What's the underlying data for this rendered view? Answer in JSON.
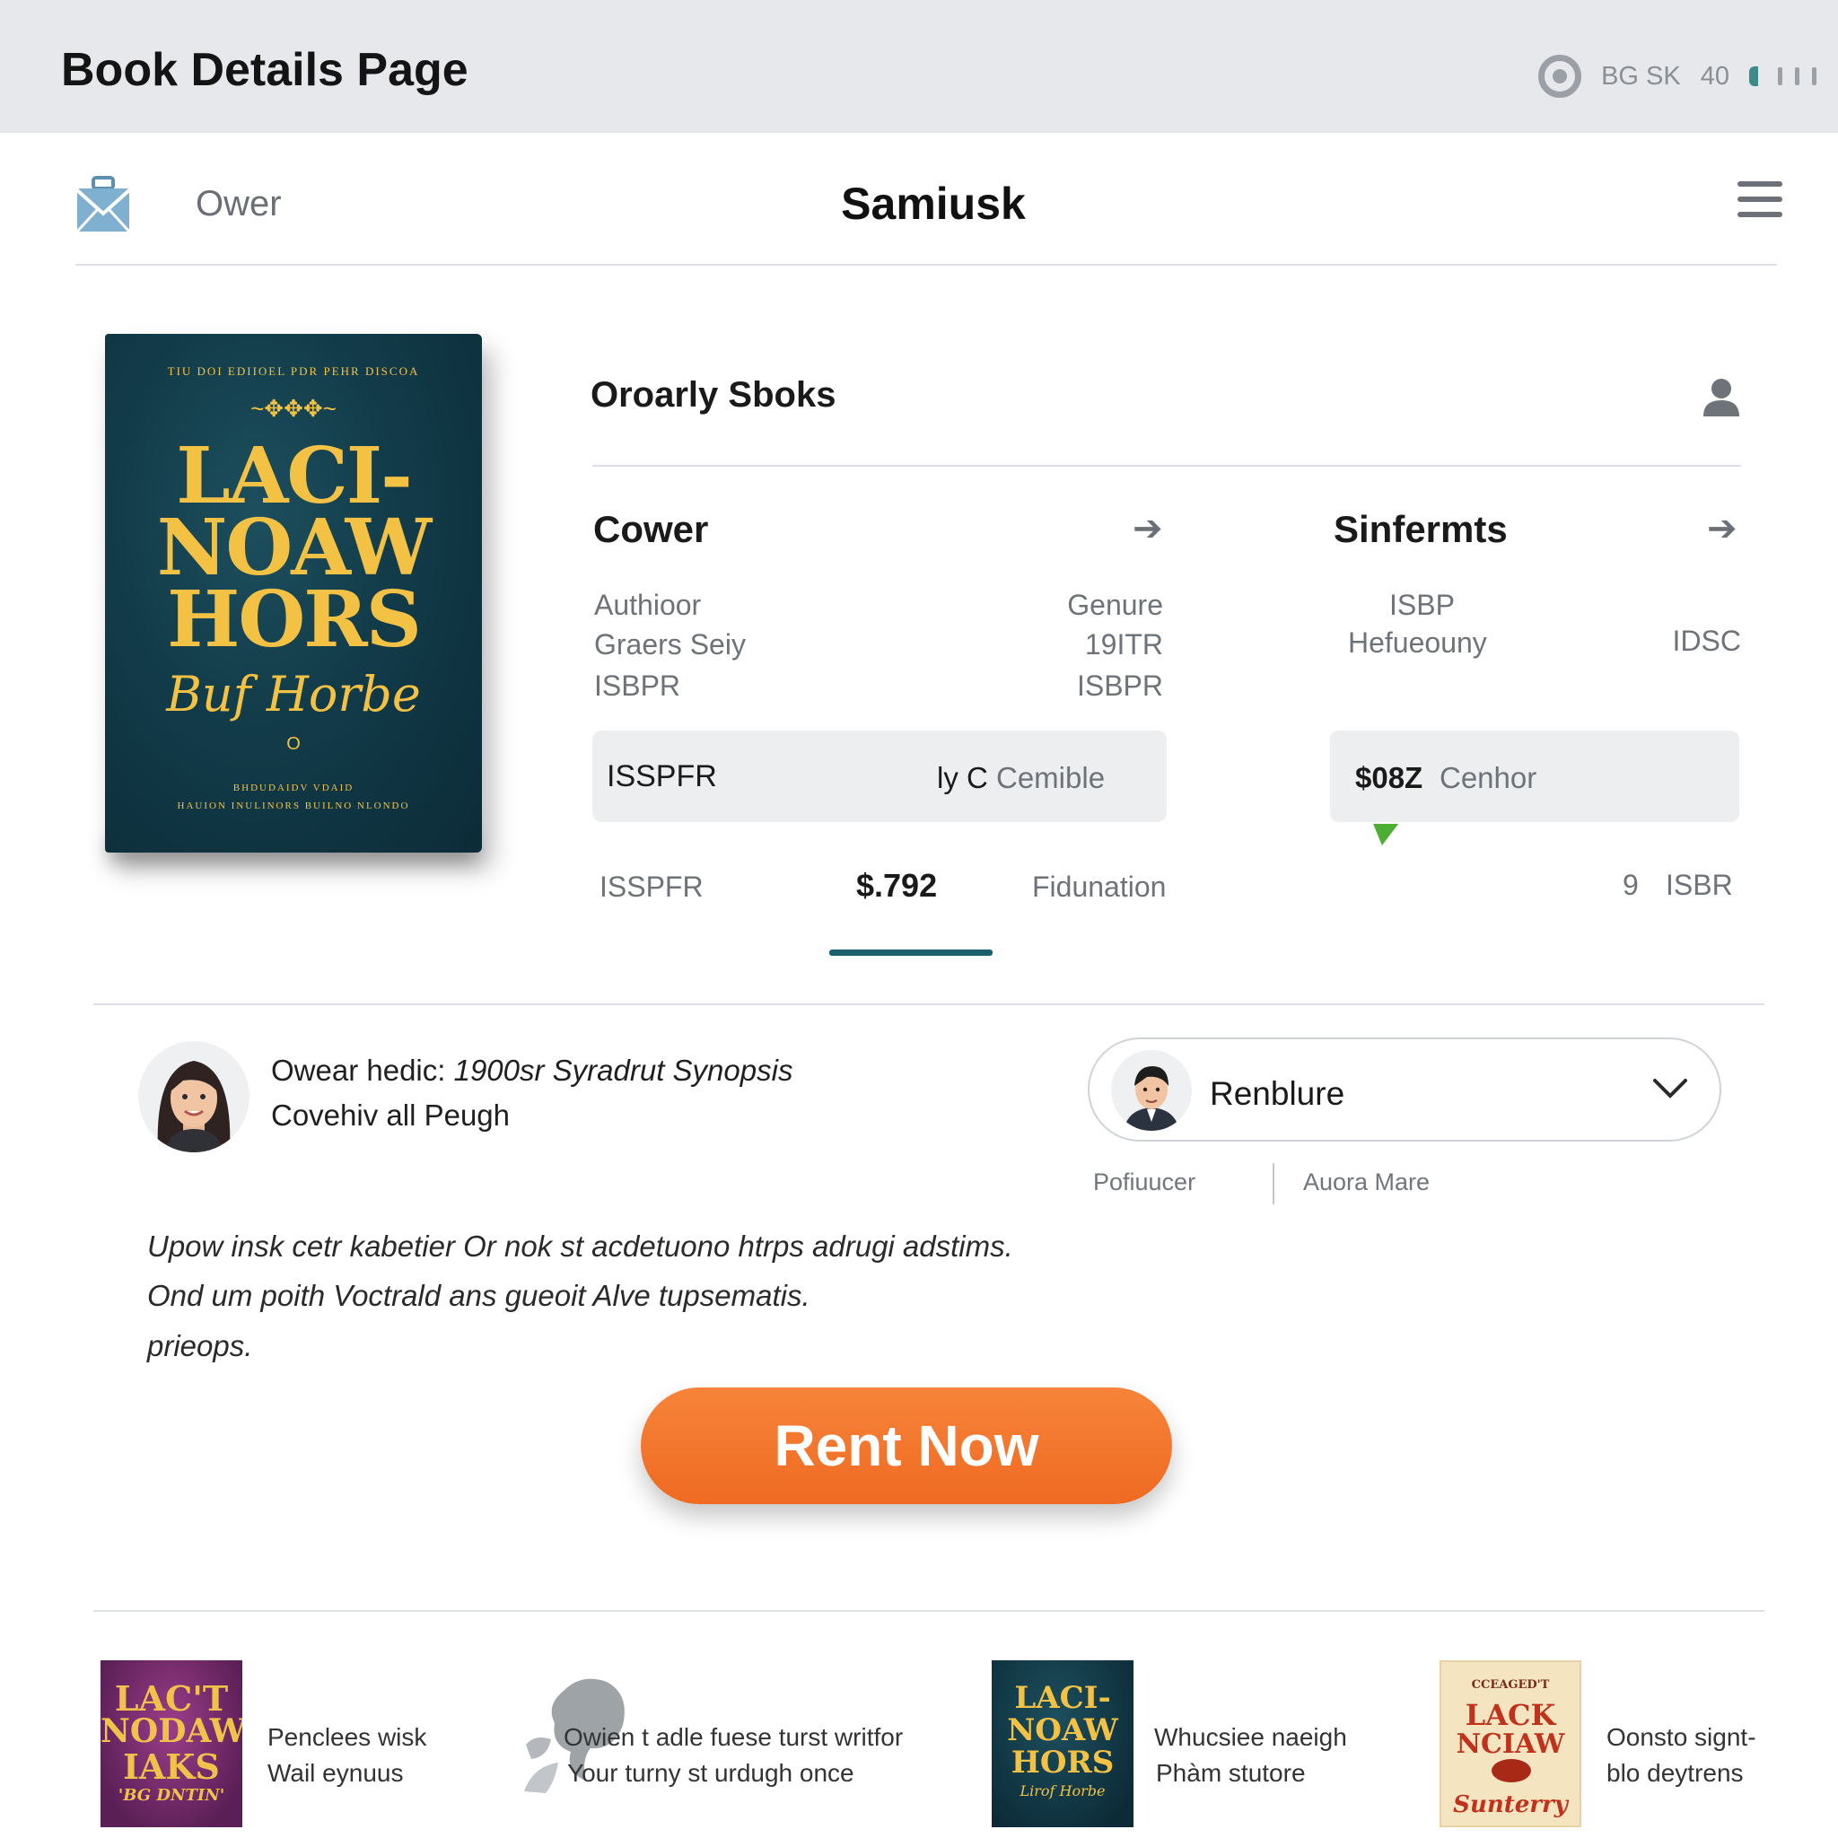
{
  "topbar": {
    "title": "Book Details Page",
    "status_text": "BG SK",
    "status_num": "40"
  },
  "nav": {
    "left_label": "Ower",
    "center_title": "Samiusk"
  },
  "book": {
    "cover": {
      "top_line": "TIU DOI EDIIOEL PDR PEHR DISCOA",
      "title_1": "LACI-",
      "title_2": "NOAW",
      "title_3": "HORS",
      "script": "Buf Horbe",
      "mark": "O",
      "bottom_1": "BHDUDAIDV VDAID",
      "bottom_2": "HAUION INULINORS BUILNO NLONDO"
    },
    "detail_title": "Oroarly Sboks",
    "sec1": {
      "title": "Cower",
      "rows": [
        [
          "Authioor",
          "Genure"
        ],
        [
          "Graers Seiy",
          "19ITR"
        ],
        [
          "ISBPR",
          "ISBPR"
        ]
      ]
    },
    "sec2": {
      "title": "Sinfermts",
      "row1": "ISBP",
      "row2_left": "Hefueouny",
      "row2_right": "IDSC"
    },
    "pill1": {
      "left": "ISSPFR",
      "mid": "ly C",
      "right": "Cemible"
    },
    "pill2": {
      "strong": "$08Z",
      "rest": "Cenhor"
    },
    "bottom_row": {
      "left": "ISSPFR",
      "price": "$.792",
      "mid": "Fidunation",
      "num": "9",
      "right": "ISBR"
    }
  },
  "synopsis": {
    "line1_a": "Owear hedic: ",
    "line1_b": "1900sr Syradrut Synopsis",
    "line2": "Covehiv all Peugh"
  },
  "dropdown": {
    "label": "Renblure"
  },
  "meta": {
    "left": "Pofiuucer",
    "right": "Auora Mare"
  },
  "description": [
    "Upow  insk cetr kabetier Or nok st acdetuono htrps adrugi adstims.",
    "Ond um poith  Voctrald ans gueoit  Alve tupsematis.",
    "prieops."
  ],
  "cta": {
    "label": "Rent Now"
  },
  "related": [
    {
      "cover_lines": [
        "LAC'T",
        "NODAW",
        "IAKS",
        "'BG DNTIN'"
      ],
      "line1": "Penclees wisk",
      "line2": "Wail eynuus"
    },
    {
      "line1": "Owien t adle fuese turst writfor",
      "line2": "Your turny st urdugh once"
    },
    {
      "cover_lines": [
        "LACI-",
        "NOAW",
        "HORS",
        "Lirof Horbe"
      ],
      "line1": "Whucsiee naeigh",
      "line2": "Phàm stutore"
    },
    {
      "cover_lines": [
        "CCEAGED'T",
        "LACK",
        "NCIAW",
        "Sunterry"
      ],
      "line1": "Oonsto signt-",
      "line2": "blo deytrens"
    }
  ],
  "colors": {
    "accent_orange": "#f07a30",
    "teal_underline": "#1b5e6e",
    "cover_gold": "#f3c244",
    "cover_navy": "#123b49"
  }
}
